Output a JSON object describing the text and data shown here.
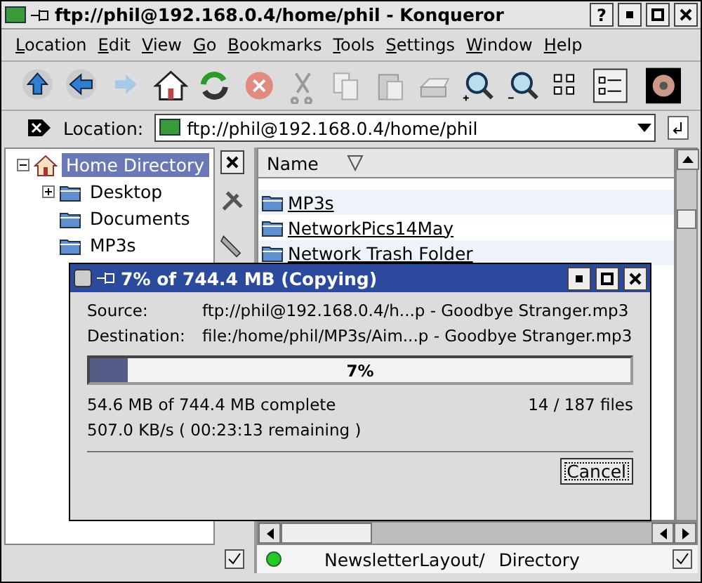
{
  "window": {
    "title": "ftp://phil@192.168.0.4/home/phil - Konqueror",
    "help": "?"
  },
  "menu": [
    "Location",
    "Edit",
    "View",
    "Go",
    "Bookmarks",
    "Tools",
    "Settings",
    "Window",
    "Help"
  ],
  "location": {
    "label": "Location:",
    "value": "ftp://phil@192.168.0.4/home/phil"
  },
  "tree": [
    {
      "label": "Home Directory",
      "selected": true,
      "expanded": true,
      "children": [
        {
          "label": "Desktop",
          "selected": false,
          "expanded": false
        },
        {
          "label": "Documents",
          "selected": false
        },
        {
          "label": "MP3s",
          "selected": false
        }
      ]
    }
  ],
  "files": {
    "columns": [
      "Name"
    ],
    "rows": [
      {
        "name": "MP3s"
      },
      {
        "name": "NetworkPics14May"
      },
      {
        "name": "Network Trash Folder"
      }
    ]
  },
  "dialog": {
    "title": "7% of 744.4 MB  (Copying)",
    "fields": [
      {
        "label": "Source:",
        "value": "ftp://phil@192.168.0.4/h...p - Goodbye Stranger.mp3"
      },
      {
        "label": "Destination:",
        "value": "file:/home/phil/MP3s/Aim...p - Goodbye Stranger.mp3"
      }
    ],
    "progress": {
      "level": 0.07,
      "label": "7%"
    },
    "size_text": "54.6 MB of 744.4 MB complete",
    "files_text": "14 / 187 files",
    "speed_text": "507.0 KB/s ( 00:23:13 remaining )",
    "button": "Cancel"
  },
  "status": {
    "name": "NewsletterLayout/",
    "type": "Directory"
  }
}
